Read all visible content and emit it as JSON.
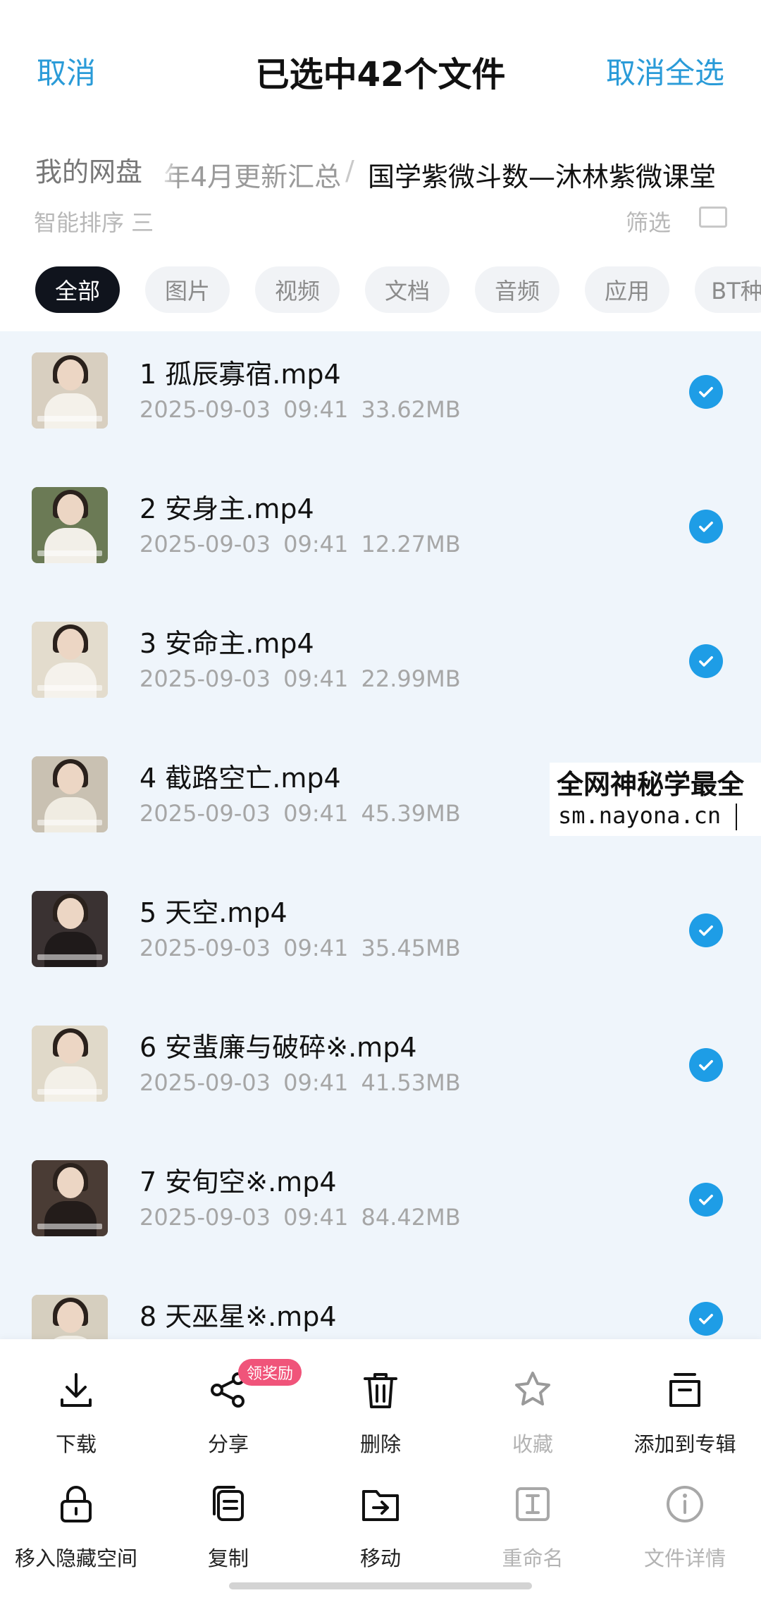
{
  "header": {
    "cancel_label": "取消",
    "title": "已选中42个文件",
    "deselect_all_label": "取消全选"
  },
  "breadcrumb": {
    "root": "我的网盘",
    "middle": "年4月更新汇总",
    "separator": "/",
    "current": "国学紫微斗数—沐林紫微课堂"
  },
  "sort_row": {
    "sort_label": "智能排序 三",
    "filter_label": "筛选 ",
    "view_icon": "grid-view-icon"
  },
  "tabs": [
    {
      "label": "全部",
      "active": true
    },
    {
      "label": "图片",
      "active": false
    },
    {
      "label": "视频",
      "active": false
    },
    {
      "label": "文档",
      "active": false
    },
    {
      "label": "音频",
      "active": false
    },
    {
      "label": "应用",
      "active": false
    },
    {
      "label": "BT种",
      "active": false
    }
  ],
  "files": [
    {
      "name": "1 孤辰寡宿.mp4",
      "date": "2025-09-03",
      "time": "09:41",
      "size": "33.62MB",
      "selected": true
    },
    {
      "name": "2 安身主.mp4",
      "date": "2025-09-03",
      "time": "09:41",
      "size": "12.27MB",
      "selected": true
    },
    {
      "name": "3 安命主.mp4",
      "date": "2025-09-03",
      "time": "09:41",
      "size": "22.99MB",
      "selected": true
    },
    {
      "name": "4 截路空亡.mp4",
      "date": "2025-09-03",
      "time": "09:41",
      "size": "45.39MB",
      "selected": true
    },
    {
      "name": "5 天空.mp4",
      "date": "2025-09-03",
      "time": "09:41",
      "size": "35.45MB",
      "selected": true
    },
    {
      "name": "6 安蜚廉与破碎※.mp4",
      "date": "2025-09-03",
      "time": "09:41",
      "size": "41.53MB",
      "selected": true
    },
    {
      "name": "7 安旬空※.mp4",
      "date": "2025-09-03",
      "time": "09:41",
      "size": "84.42MB",
      "selected": true
    },
    {
      "name": "8 天巫星※.mp4",
      "date": "",
      "time": "",
      "size": "",
      "selected": true
    }
  ],
  "watermark": {
    "line1": "全网神秘学最全",
    "line2": "sm.nayona.cn"
  },
  "toolbar": {
    "row1": [
      {
        "label": "下载",
        "icon": "download-icon",
        "disabled": false
      },
      {
        "label": "分享",
        "icon": "share-icon",
        "disabled": false,
        "badge": "领奖励"
      },
      {
        "label": "删除",
        "icon": "trash-icon",
        "disabled": false
      },
      {
        "label": "收藏",
        "icon": "star-icon",
        "disabled": true
      },
      {
        "label": "添加到专辑",
        "icon": "album-icon",
        "disabled": false
      }
    ],
    "row2": [
      {
        "label": "移入隐藏空间",
        "icon": "lock-icon",
        "disabled": false
      },
      {
        "label": "复制",
        "icon": "copy-icon",
        "disabled": false
      },
      {
        "label": "移动",
        "icon": "move-icon",
        "disabled": false
      },
      {
        "label": "重命名",
        "icon": "rename-icon",
        "disabled": true
      },
      {
        "label": "文件详情",
        "icon": "info-icon",
        "disabled": true
      }
    ]
  },
  "colors": {
    "accent": "#2a9bd8",
    "check": "#1e9de6",
    "badge": "#f0547a",
    "active_tab": "#10141d",
    "list_bg": "#eff5fb"
  }
}
